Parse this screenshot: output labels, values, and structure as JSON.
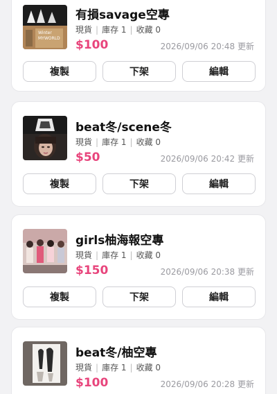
{
  "listings": [
    {
      "title": "有損savage空專",
      "status": "現貨",
      "stock": "庫存 1",
      "favorites": "收藏 0",
      "price": "$100",
      "updated": "2026/09/06 20:48 更新",
      "thumbnail": "album-cover-photo"
    },
    {
      "title": "beat冬/scene冬",
      "status": "現貨",
      "stock": "庫存 1",
      "favorites": "收藏 0",
      "price": "$50",
      "updated": "2026/09/06 20:42 更新",
      "thumbnail": "photocard-photo"
    },
    {
      "title": "girls柚海報空專",
      "status": "現貨",
      "stock": "庫存 1",
      "favorites": "收藏 0",
      "price": "$150",
      "updated": "2026/09/06 20:38 更新",
      "thumbnail": "group-poster-photo"
    },
    {
      "title": "beat冬/柚空專",
      "status": "現貨",
      "stock": "庫存 1",
      "favorites": "收藏 0",
      "price": "$100",
      "updated": "2026/09/06 20:28 更新",
      "thumbnail": "album-sketch-photo"
    }
  ],
  "actions": {
    "copy": "複製",
    "unlist": "下架",
    "edit": "編輯"
  },
  "colors": {
    "price": "#e8457c",
    "background": "#f2f2f4"
  }
}
